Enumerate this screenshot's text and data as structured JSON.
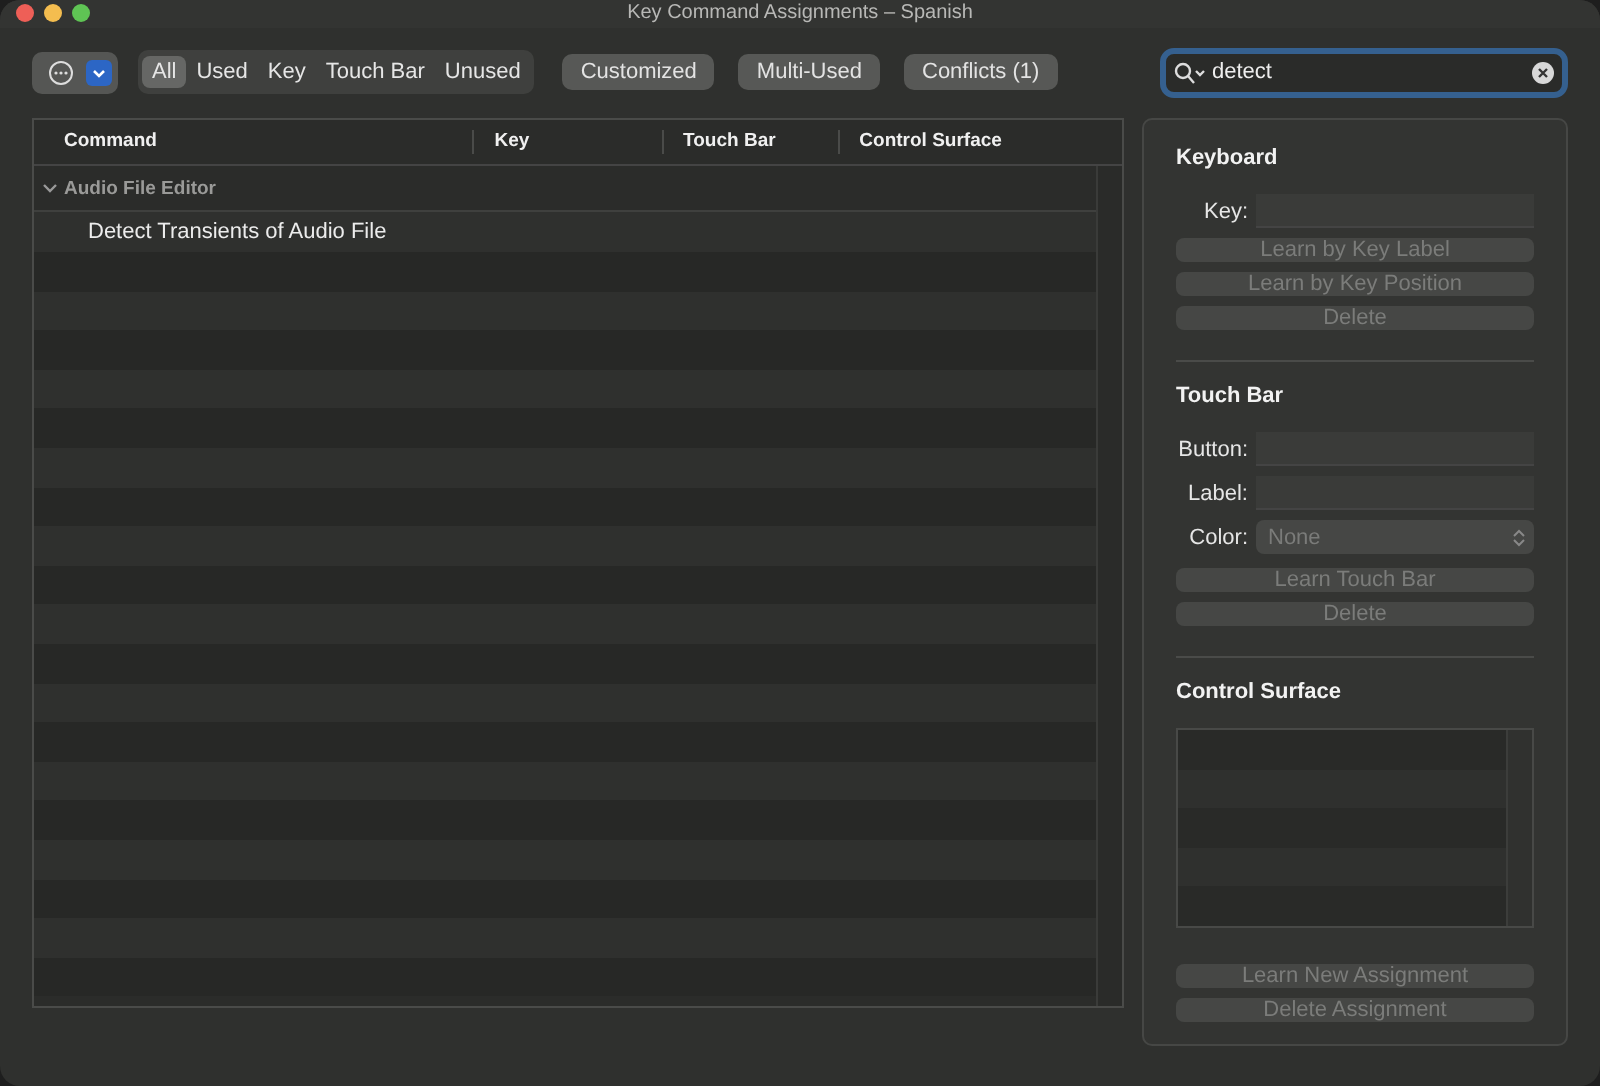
{
  "window": {
    "title": "Key Command Assignments – Spanish"
  },
  "toolbar": {
    "filters": [
      {
        "label": "All",
        "selected": true
      },
      {
        "label": "Used",
        "selected": false
      },
      {
        "label": "Key",
        "selected": false
      },
      {
        "label": "Touch Bar",
        "selected": false
      },
      {
        "label": "Unused",
        "selected": false
      }
    ],
    "toggles": [
      {
        "label": "Customized",
        "on": false
      },
      {
        "label": "Multi-Used",
        "on": false
      },
      {
        "label": "Conflicts (1)",
        "on": false
      }
    ],
    "search": {
      "value": "detect"
    }
  },
  "table": {
    "columns": [
      "Command",
      "Key",
      "Touch Bar",
      "Control Surface"
    ],
    "groups": [
      {
        "name": "Audio File Editor",
        "expanded": true,
        "rows": [
          {
            "command": "Detect Transients of Audio File",
            "selected": false
          }
        ]
      }
    ]
  },
  "keyboard": {
    "title": "Keyboard",
    "key_label": "Key:",
    "buttons": [
      {
        "label": "Learn by Key Label",
        "disabled": true
      },
      {
        "label": "Learn by Key Position",
        "disabled": true
      },
      {
        "label": "Delete",
        "disabled": true
      }
    ]
  },
  "touch_bar": {
    "title": "Touch Bar",
    "button_label": "Button:",
    "label_label": "Label:",
    "color_label": "Color:",
    "color_value": "None",
    "color_disabled": true,
    "buttons": [
      {
        "label": "Learn Touch Bar",
        "disabled": true
      },
      {
        "label": "Delete",
        "disabled": true
      }
    ]
  },
  "control_surface": {
    "title": "Control Surface",
    "buttons": [
      {
        "label": "Learn New Assignment",
        "disabled": true
      },
      {
        "label": "Delete Assignment",
        "disabled": true
      }
    ]
  }
}
